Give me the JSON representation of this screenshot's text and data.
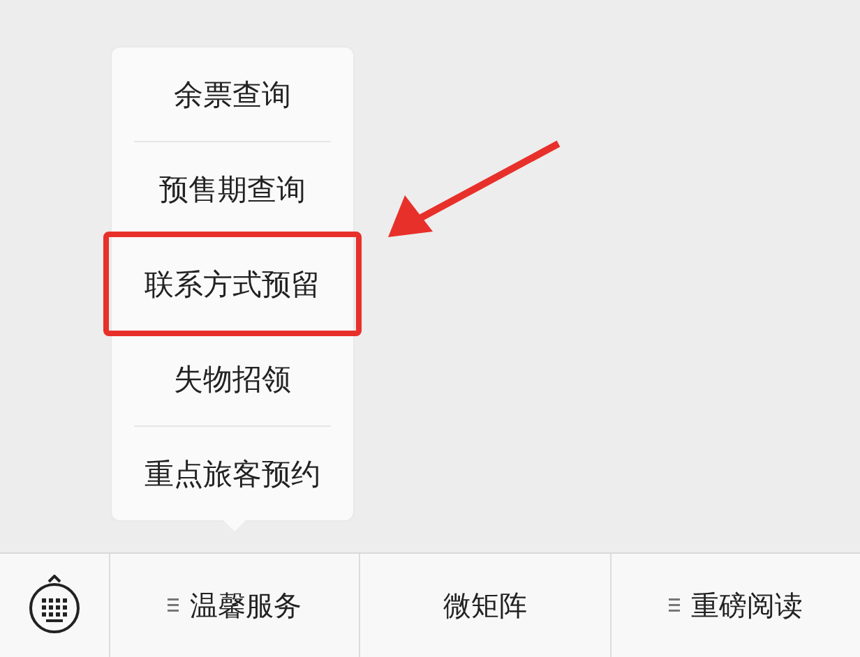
{
  "popup_menu": {
    "items": [
      {
        "label": "余票查询",
        "annotated": false
      },
      {
        "label": "预售期查询",
        "annotated": false
      },
      {
        "label": "联系方式预留",
        "annotated": true
      },
      {
        "label": "失物招领",
        "annotated": false
      },
      {
        "label": "重点旅客预约",
        "annotated": false
      }
    ]
  },
  "bottom_bar": {
    "tabs": [
      {
        "label": "温馨服务",
        "has_submenu": true
      },
      {
        "label": "微矩阵",
        "has_submenu": false
      },
      {
        "label": "重磅阅读",
        "has_submenu": true
      }
    ]
  }
}
